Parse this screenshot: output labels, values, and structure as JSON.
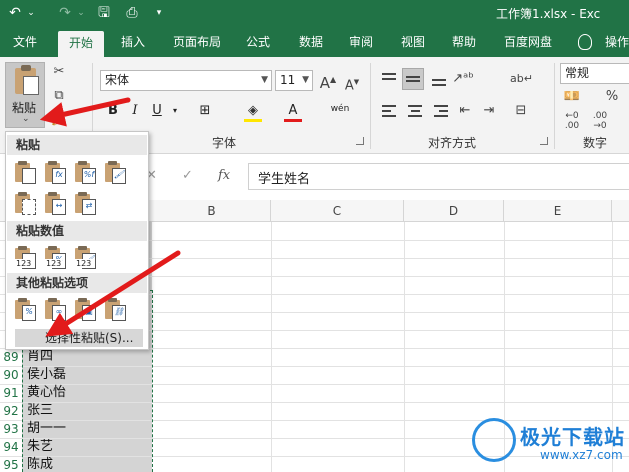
{
  "titlebar": {
    "doc_title": "工作簿1.xlsx - Exc",
    "icons": [
      "undo-icon",
      "chevron-down-icon",
      "redo-icon",
      "save-icon",
      "print-preview-icon",
      "customize-quick-access-icon"
    ]
  },
  "tabs": [
    "文件",
    "开始",
    "插入",
    "页面布局",
    "公式",
    "数据",
    "审阅",
    "视图",
    "帮助",
    "百度网盘",
    "操作"
  ],
  "active_tab": "开始",
  "ribbon": {
    "clipboard": {
      "paste_label": "粘贴"
    },
    "font": {
      "group_label": "字体",
      "font_name": "宋体",
      "font_size": "11",
      "bold": "B",
      "italic": "I",
      "underline": "U",
      "font_color_glyph": "A",
      "phonetic": "wén"
    },
    "alignment": {
      "group_label": "对齐方式"
    },
    "number": {
      "group_label": "数字",
      "format": "常规"
    }
  },
  "formula_bar": {
    "fx": "fx",
    "value": "学生姓名"
  },
  "columns": [
    "B",
    "C",
    "D",
    "E"
  ],
  "rows": [
    {
      "num": "89",
      "name": "肖四"
    },
    {
      "num": "90",
      "name": "侯小磊"
    },
    {
      "num": "91",
      "name": "黄心怡"
    },
    {
      "num": "92",
      "name": "张三"
    },
    {
      "num": "93",
      "name": "胡一一"
    },
    {
      "num": "94",
      "name": "朱艺"
    },
    {
      "num": "95",
      "name": "陈成"
    }
  ],
  "dropdown": {
    "section_paste": "粘贴",
    "section_values": "粘贴数值",
    "section_other": "其他粘贴选项",
    "paste_special": "选择性粘贴(S)...",
    "value_badge": "123"
  },
  "watermark": {
    "brand": "极光下载站",
    "url": "www.xz7.com"
  },
  "colors": {
    "excel_green": "#217346",
    "arrow_red": "#e21b1b",
    "selection_gray": "#d4d4d4"
  }
}
